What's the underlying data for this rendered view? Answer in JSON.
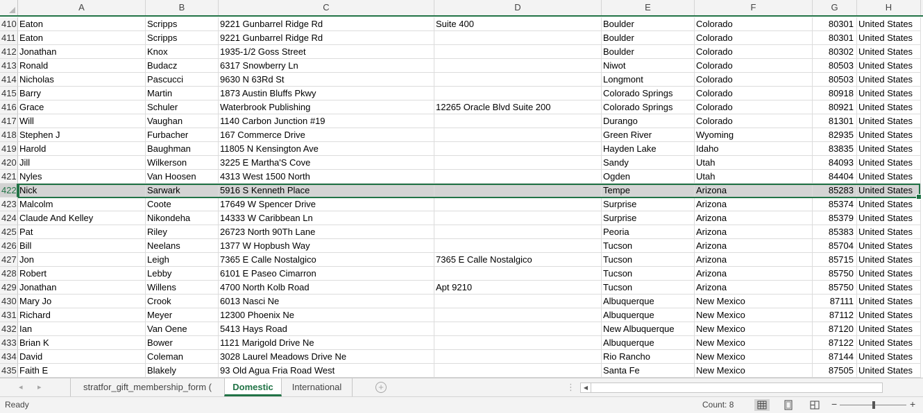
{
  "columns": [
    "A",
    "B",
    "C",
    "D",
    "E",
    "F",
    "G",
    "H"
  ],
  "rows": [
    {
      "num": "410",
      "cells": [
        "Eaton",
        "Scripps",
        "9221 Gunbarrel Ridge Rd",
        "Suite 400",
        "Boulder",
        "Colorado",
        "80301",
        "United States"
      ]
    },
    {
      "num": "411",
      "cells": [
        "Eaton",
        "Scripps",
        "9221 Gunbarrel Ridge Rd",
        "",
        "Boulder",
        "Colorado",
        "80301",
        "United States"
      ]
    },
    {
      "num": "412",
      "cells": [
        "Jonathan",
        "Knox",
        "1935-1/2 Goss Street",
        "",
        "Boulder",
        "Colorado",
        "80302",
        "United States"
      ]
    },
    {
      "num": "413",
      "cells": [
        "Ronald",
        "Budacz",
        "6317 Snowberry Ln",
        "",
        "Niwot",
        "Colorado",
        "80503",
        "United States"
      ]
    },
    {
      "num": "414",
      "cells": [
        "Nicholas",
        "Pascucci",
        "9630 N  63Rd St",
        "",
        "Longmont",
        "Colorado",
        "80503",
        "United States"
      ]
    },
    {
      "num": "415",
      "cells": [
        "Barry",
        "Martin",
        "1873 Austin Bluffs Pkwy",
        "",
        "Colorado Springs",
        "Colorado",
        "80918",
        "United States"
      ]
    },
    {
      "num": "416",
      "cells": [
        "Grace",
        "Schuler",
        "Waterbrook Publishing",
        "12265 Oracle Blvd  Suite 200",
        "Colorado Springs",
        "Colorado",
        "80921",
        "United States"
      ]
    },
    {
      "num": "417",
      "cells": [
        "Will",
        "Vaughan",
        "1140 Carbon Junction  #19",
        "",
        "Durango",
        "Colorado",
        "81301",
        "United States"
      ]
    },
    {
      "num": "418",
      "cells": [
        "Stephen J",
        "Furbacher",
        "167 Commerce Drive",
        "",
        "Green River",
        "Wyoming",
        "82935",
        "United States"
      ]
    },
    {
      "num": "419",
      "cells": [
        "Harold",
        "Baughman",
        "11805 N  Kensington Ave",
        "",
        "Hayden Lake",
        "Idaho",
        "83835",
        "United States"
      ]
    },
    {
      "num": "420",
      "cells": [
        "Jill",
        "Wilkerson",
        "3225 E  Martha'S Cove",
        "",
        "Sandy",
        "Utah",
        "84093",
        "United States"
      ]
    },
    {
      "num": "421",
      "cells": [
        "Nyles",
        "Van Hoosen",
        "4313 West 1500 North",
        "",
        "Ogden",
        "Utah",
        "84404",
        "United States"
      ]
    },
    {
      "num": "422",
      "cells": [
        "Nick",
        "Sarwark",
        "5916 S  Kenneth Place",
        "",
        "Tempe",
        "Arizona",
        "85283",
        "United States"
      ]
    },
    {
      "num": "423",
      "cells": [
        "Malcolm",
        "Coote",
        "17649 W  Spencer Drive",
        "",
        "Surprise",
        "Arizona",
        "85374",
        "United States"
      ]
    },
    {
      "num": "424",
      "cells": [
        "Claude And Kelley",
        "Nikondeha",
        "14333 W  Caribbean Ln",
        "",
        "Surprise",
        "Arizona",
        "85379",
        "United States"
      ]
    },
    {
      "num": "425",
      "cells": [
        "Pat",
        "Riley",
        "26723 North 90Th Lane",
        "",
        "Peoria",
        "Arizona",
        "85383",
        "United States"
      ]
    },
    {
      "num": "426",
      "cells": [
        "Bill",
        "Neelans",
        "1377 W  Hopbush Way",
        "",
        "Tucson",
        "Arizona",
        "85704",
        "United States"
      ]
    },
    {
      "num": "427",
      "cells": [
        "Jon",
        "Leigh",
        "7365 E  Calle Nostalgico",
        "7365 E  Calle Nostalgico",
        "Tucson",
        "Arizona",
        "85715",
        "United States"
      ]
    },
    {
      "num": "428",
      "cells": [
        "Robert",
        "Lebby",
        "6101 E  Paseo Cimarron",
        "",
        "Tucson",
        "Arizona",
        "85750",
        "United States"
      ]
    },
    {
      "num": "429",
      "cells": [
        "Jonathan",
        "Willens",
        "4700 North Kolb Road",
        "Apt 9210",
        "Tucson",
        "Arizona",
        "85750",
        "United States"
      ]
    },
    {
      "num": "430",
      "cells": [
        "Mary Jo",
        "Crook",
        "6013 Nasci Ne",
        "",
        "Albuquerque",
        "New Mexico",
        "87111",
        "United States"
      ]
    },
    {
      "num": "431",
      "cells": [
        "Richard",
        "Meyer",
        "12300 Phoenix Ne",
        "",
        "Albuquerque",
        "New Mexico",
        "87112",
        "United States"
      ]
    },
    {
      "num": "432",
      "cells": [
        "Ian",
        "Van Oene",
        "5413 Hays Road",
        "",
        "New Albuquerque",
        "New Mexico",
        "87120",
        "United States"
      ]
    },
    {
      "num": "433",
      "cells": [
        "Brian K",
        "Bower",
        "1121 Marigold Drive Ne",
        "",
        "Albuquerque",
        "New Mexico",
        "87122",
        "United States"
      ]
    },
    {
      "num": "434",
      "cells": [
        "David",
        "Coleman",
        "3028 Laurel Meadows Drive Ne",
        "",
        "Rio Rancho",
        "New Mexico",
        "87144",
        "United States"
      ]
    },
    {
      "num": "435",
      "cells": [
        "Faith E",
        "Blakely",
        "93 Old Agua Fria Road West",
        "",
        "Santa Fe",
        "New Mexico",
        "87505",
        "United States"
      ]
    }
  ],
  "selected_row": "422",
  "tabs": [
    {
      "label": "stratfor_gift_membership_form (",
      "active": false
    },
    {
      "label": "Domestic",
      "active": true
    },
    {
      "label": "International",
      "active": false
    }
  ],
  "tab_nav": {
    "prev": "◂",
    "next": "▸"
  },
  "add_sheet": "+",
  "status": {
    "ready": "Ready",
    "count": "Count: 8"
  },
  "zoom": {
    "minus": "−",
    "plus": "+"
  },
  "colors": {
    "accent": "#217346",
    "selection": "#d4d4d4"
  },
  "icons": [
    "normal-view-icon",
    "page-layout-view-icon",
    "page-break-view-icon"
  ]
}
